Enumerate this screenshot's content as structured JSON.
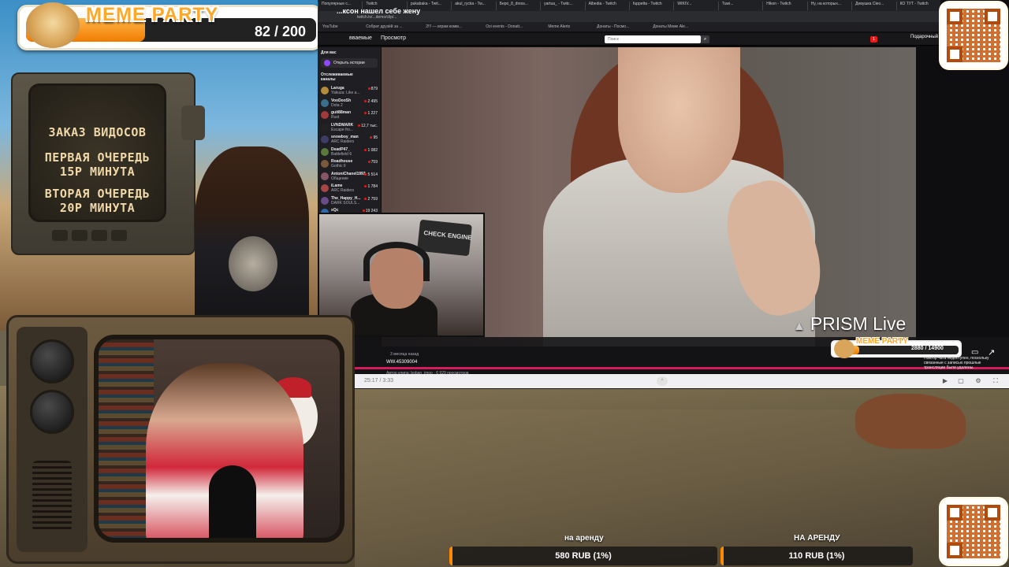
{
  "meme_bar": {
    "title": "MEME PARTY",
    "count": "82 / 200",
    "progress": 0.41
  },
  "pipboy": {
    "line1": "ЗАКАЗ ВИДОСОВ",
    "line2a": "ПЕРВАЯ ОЧЕРЕДЬ",
    "line2b": "15Р МИНУТА",
    "line3a": "ВТОРАЯ ОЧЕРЕДЬ",
    "line3b": "20Р МИНУТА"
  },
  "browser": {
    "tabs": [
      "Популярные с...",
      "Twitch",
      "pukabaka - Twit...",
      "akul_rycka - Tw...",
      "Беро_8_dress...",
      "yartua_ - Twitc...",
      "Albedia - Twitch",
      "fuppetta - Twitch",
      "WIKIV...",
      "Tuwi...",
      "Hikon - Twitch",
      "Ну, на которых...",
      "Девушка Cleo...",
      "КО ТУТ - Twitch"
    ],
    "page_title": "...ксон нашел себе жену",
    "url": "twitch.tv/...demo/clip/...",
    "bookmarks": [
      "YouTube",
      "Собрат друзёй за ...",
      "2!!! — играм комм...",
      "Ozi events - Donatt...",
      "Meme Alerts",
      "Донаты - Посмо...",
      "Донаты Меме Ale..."
    ],
    "nav": {
      "following": "вваемые",
      "browse": "Просмотр",
      "search_placeholder": "Поиск",
      "notif_count": "1",
      "subscribe": "Подарочный Ти"
    }
  },
  "sidebar": {
    "header": "Для вас",
    "history": "Открыть истории",
    "followed": "Отслеживаемые каналы",
    "channels": [
      {
        "name": "Laruga",
        "game": "Yakuza: Like a...",
        "viewers": "879",
        "color": "#b58b3a"
      },
      {
        "name": "VooDooSh",
        "game": "Dota 2",
        "viewers": "2 495",
        "color": "#3b6e8a"
      },
      {
        "name": "guit88man",
        "game": "Rust",
        "viewers": "1 227",
        "color": "#a33a3a"
      },
      {
        "name": "LVNDMARK",
        "game": "Escape fro...",
        "viewers": "12,7 тыс.",
        "color": "#222"
      },
      {
        "name": "snowboy_man",
        "game": "ARC Raiders",
        "viewers": "95",
        "color": "#3c3c66"
      },
      {
        "name": "DeadP47_",
        "game": "Battlefield 6",
        "viewers": "1 082",
        "color": "#5a7a3a"
      },
      {
        "name": "Roadhouse",
        "game": "Gothic II",
        "viewers": "759",
        "color": "#7a5a3a"
      },
      {
        "name": "AntoniChanel1993",
        "game": "Общение",
        "viewers": "5 514",
        "color": "#885566"
      },
      {
        "name": "iLame",
        "game": "ARC Raiders",
        "viewers": "1 784",
        "color": "#aa4444"
      },
      {
        "name": "The_Happy_H...",
        "game": "DARK SOULS...",
        "viewers": "2 759",
        "color": "#6b4b8b"
      },
      {
        "name": "xQc",
        "game": "",
        "viewers": "19 243",
        "color": "#2a6ab0"
      }
    ]
  },
  "video": {
    "watermark": "PRISM Live"
  },
  "webcam": {
    "sign_text": "CHECK ENGINE"
  },
  "player": {
    "date": "3 месяца назад",
    "clip_id": "WW.45309004",
    "meta": "Автор клипа: boban_imoo · 6 929 просмотров",
    "time": "25:17 / 3:33",
    "chat_note": "Повтор чата недоступен, поскольку связанные с записью прошлые трансляции были удалены.",
    "progress": 1.0
  },
  "mini_meme": {
    "title": "MEME PARTY",
    "count": "2880 / 14900",
    "progress": 0.19
  },
  "rent": [
    {
      "label": "на аренду",
      "price": "580 RUB (1%)"
    },
    {
      "label": "НА АРЕНДУ",
      "price": "110 RUB (1%)"
    }
  ],
  "colors": {
    "accent_orange": "#f07c00",
    "twitch_dark": "#18181b",
    "live_red": "#e91916",
    "progress_pink": "#d61a5b"
  }
}
